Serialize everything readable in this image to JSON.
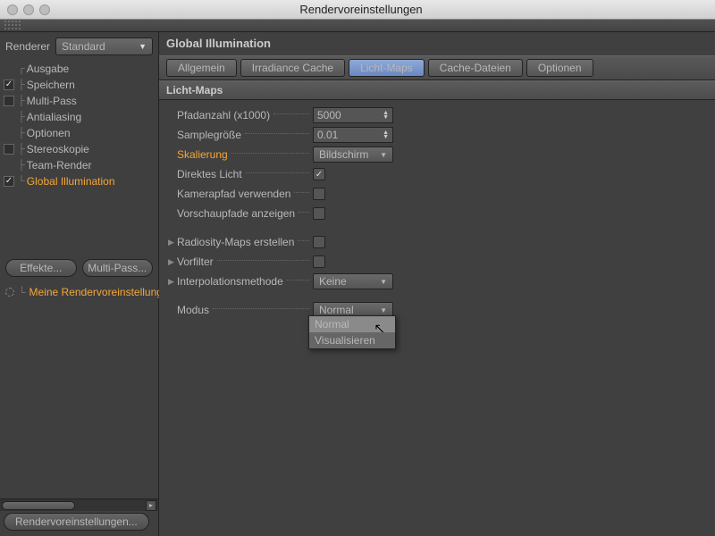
{
  "window": {
    "title": "Rendervoreinstellungen"
  },
  "sidebar": {
    "rendererLabel": "Renderer",
    "rendererValue": "Standard",
    "items": [
      {
        "label": "Ausgabe",
        "checked": null
      },
      {
        "label": "Speichern",
        "checked": true
      },
      {
        "label": "Multi-Pass",
        "checked": false
      },
      {
        "label": "Antialiasing",
        "checked": null
      },
      {
        "label": "Optionen",
        "checked": null
      },
      {
        "label": "Stereoskopie",
        "checked": false
      },
      {
        "label": "Team-Render",
        "checked": null
      },
      {
        "label": "Global Illumination",
        "checked": true,
        "highlight": true
      }
    ],
    "effectsBtn": "Effekte...",
    "multipassBtn": "Multi-Pass...",
    "presetLabel": "Meine Rendervoreinstellung",
    "footerBtn": "Rendervoreinstellungen..."
  },
  "main": {
    "title": "Global Illumination",
    "tabs": [
      "Allgemein",
      "Irradiance Cache",
      "Licht-Maps",
      "Cache-Dateien",
      "Optionen"
    ],
    "activeTab": 2,
    "sectionTitle": "Licht-Maps",
    "fields": {
      "pfadanzahl": {
        "label": "Pfadanzahl (x1000)",
        "value": "5000"
      },
      "samplegroesse": {
        "label": "Samplegröße",
        "value": "0.01"
      },
      "skalierung": {
        "label": "Skalierung",
        "value": "Bildschirm",
        "highlight": true
      },
      "direktesLicht": {
        "label": "Direktes Licht",
        "checked": true
      },
      "kamerapfad": {
        "label": "Kamerapfad verwenden",
        "checked": false
      },
      "vorschaupfade": {
        "label": "Vorschaupfade anzeigen",
        "checked": false
      },
      "radiosity": {
        "label": "Radiosity-Maps erstellen",
        "checked": false
      },
      "vorfilter": {
        "label": "Vorfilter",
        "checked": false
      },
      "interpolation": {
        "label": "Interpolationsmethode",
        "value": "Keine"
      },
      "modus": {
        "label": "Modus",
        "value": "Normal"
      }
    },
    "popup": {
      "options": [
        "Normal",
        "Visualisieren"
      ],
      "selected": 0
    }
  }
}
